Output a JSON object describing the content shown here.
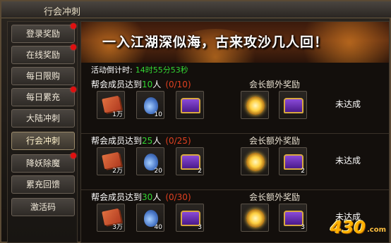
{
  "window": {
    "title": "行会冲刺"
  },
  "sidebar": {
    "items": [
      {
        "label": "登录奖励",
        "badge": true,
        "active": false
      },
      {
        "label": "在线奖励",
        "badge": true,
        "active": false
      },
      {
        "label": "每日限购",
        "badge": false,
        "active": false
      },
      {
        "label": "每日累充",
        "badge": true,
        "active": false
      },
      {
        "label": "大陆冲刺",
        "badge": false,
        "active": false
      },
      {
        "label": "行会冲刺",
        "badge": false,
        "active": true
      },
      {
        "label": "降妖除魔",
        "badge": true,
        "active": false
      },
      {
        "label": "累充回馈",
        "badge": false,
        "active": false
      },
      {
        "label": "激活码",
        "badge": false,
        "active": false
      }
    ]
  },
  "banner": {
    "slogan": "一入江湖深似海，古来攻沙几人回！"
  },
  "countdown": {
    "label": "活动倒计时:",
    "value": "14时55分53秒"
  },
  "tiers": [
    {
      "req_prefix": "帮会成员达到",
      "req_num": "10",
      "req_unit": "人",
      "progress": "(0/10)",
      "bonus_title": "会长额外奖励",
      "status": "未达成",
      "rewards": [
        {
          "icon": "book-icon",
          "qty": "1万"
        },
        {
          "icon": "bag-icon",
          "qty": "10"
        },
        {
          "icon": "chest-icon",
          "qty": ""
        }
      ],
      "bonus": [
        {
          "icon": "orb-icon",
          "qty": ""
        },
        {
          "icon": "chest-icon",
          "qty": ""
        }
      ]
    },
    {
      "req_prefix": "帮会成员达到",
      "req_num": "25",
      "req_unit": "人",
      "progress": "(0/25)",
      "bonus_title": "会长额外奖励",
      "status": "未达成",
      "rewards": [
        {
          "icon": "book-icon",
          "qty": "2万"
        },
        {
          "icon": "bag-icon",
          "qty": "20"
        },
        {
          "icon": "chest-icon",
          "qty": "2"
        }
      ],
      "bonus": [
        {
          "icon": "orb-icon",
          "qty": ""
        },
        {
          "icon": "chest-icon",
          "qty": "2"
        }
      ]
    },
    {
      "req_prefix": "帮会成员达到",
      "req_num": "30",
      "req_unit": "人",
      "progress": "(0/30)",
      "bonus_title": "会长额外奖励",
      "status": "未达成",
      "rewards": [
        {
          "icon": "book-icon",
          "qty": "3万"
        },
        {
          "icon": "bag-icon",
          "qty": "40"
        },
        {
          "icon": "chest-icon",
          "qty": "3"
        }
      ],
      "bonus": [
        {
          "icon": "orb-icon",
          "qty": ""
        },
        {
          "icon": "chest-icon",
          "qty": "3"
        }
      ]
    }
  ],
  "watermark": {
    "text": "430",
    "suffix": ".com"
  }
}
